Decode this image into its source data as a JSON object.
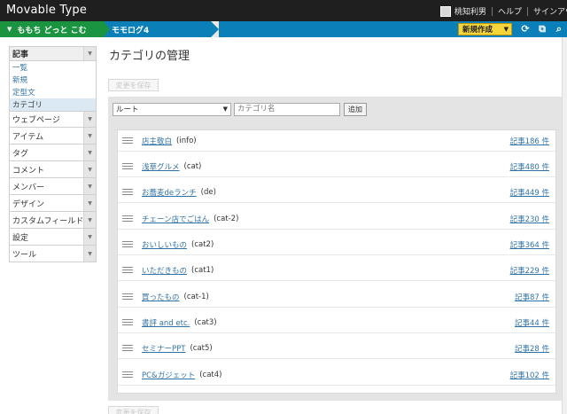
{
  "app": {
    "title": "Movable Type",
    "user_name": "桃知利男",
    "help_label": "ヘルプ",
    "signout_label": "サインアウト"
  },
  "blogbar": {
    "site_name": "ももち どっと こむ",
    "blog_name": "モモログ4",
    "new_button_label": "新規作成"
  },
  "sidebar": {
    "active_section": "記事",
    "sub_items": [
      {
        "label": "一覧"
      },
      {
        "label": "新規"
      },
      {
        "label": "定型文"
      },
      {
        "label": "カテゴリ"
      }
    ],
    "items": [
      {
        "label": "ウェブページ"
      },
      {
        "label": "アイテム"
      },
      {
        "label": "タグ"
      },
      {
        "label": "コメント"
      },
      {
        "label": "メンバー"
      },
      {
        "label": "デザイン"
      },
      {
        "label": "カスタムフィールド"
      },
      {
        "label": "設定"
      },
      {
        "label": "ツール"
      }
    ]
  },
  "main": {
    "title": "カテゴリの管理",
    "save_label": "変更を保存",
    "parent_select_value": "ルート",
    "name_placeholder": "カテゴリ名",
    "add_label": "追加",
    "categories": [
      {
        "name": "店主敬白",
        "basename": "(info)",
        "count": "記事186 件"
      },
      {
        "name": "浅草グルメ",
        "basename": "(cat)",
        "count": "記事480 件"
      },
      {
        "name": "お蕎麦deランチ",
        "basename": "(de)",
        "count": "記事449 件"
      },
      {
        "name": "チェーン店でごはん",
        "basename": "(cat-2)",
        "count": "記事230 件"
      },
      {
        "name": "おいしいもの",
        "basename": "(cat2)",
        "count": "記事364 件"
      },
      {
        "name": "いただきもの",
        "basename": "(cat1)",
        "count": "記事229 件"
      },
      {
        "name": "買ったもの",
        "basename": "(cat-1)",
        "count": "記事87 件"
      },
      {
        "name": "書評 and etc.",
        "basename": "(cat3)",
        "count": "記事44 件"
      },
      {
        "name": "セミナーPPT",
        "basename": "(cat5)",
        "count": "記事28 件"
      },
      {
        "name": "PC&ガジェット",
        "basename": "(cat4)",
        "count": "記事102 件"
      }
    ]
  },
  "colors": {
    "site_green": "#1a9440",
    "blog_blue": "#0a7fb8",
    "new_button_yellow": "#f5d53a",
    "link_blue": "#3173a6"
  }
}
